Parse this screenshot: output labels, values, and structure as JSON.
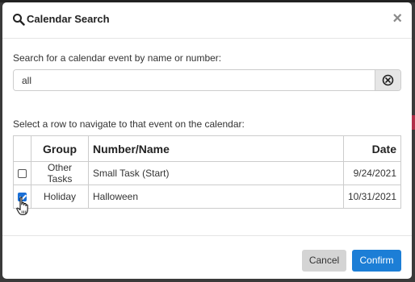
{
  "dialog": {
    "title": "Calendar Search",
    "close_label": "×"
  },
  "search": {
    "label": "Search for a calendar event by name or number:",
    "value": "all",
    "clear_icon": "circle-x-icon"
  },
  "results": {
    "label": "Select a row to navigate to that event on the calendar:",
    "columns": [
      "",
      "Group",
      "Number/Name",
      "Date"
    ],
    "rows": [
      {
        "checked": false,
        "group": "Other Tasks",
        "name": "Small Task (Start)",
        "date": "9/24/2021"
      },
      {
        "checked": true,
        "group": "Holiday",
        "name": "Halloween",
        "date": "10/31/2021"
      }
    ]
  },
  "footer": {
    "cancel_label": "Cancel",
    "confirm_label": "Confirm"
  },
  "colors": {
    "primary": "#1c7ed6",
    "cancel_bg": "#d4d4d4",
    "overlay": "#3a3a3a"
  }
}
